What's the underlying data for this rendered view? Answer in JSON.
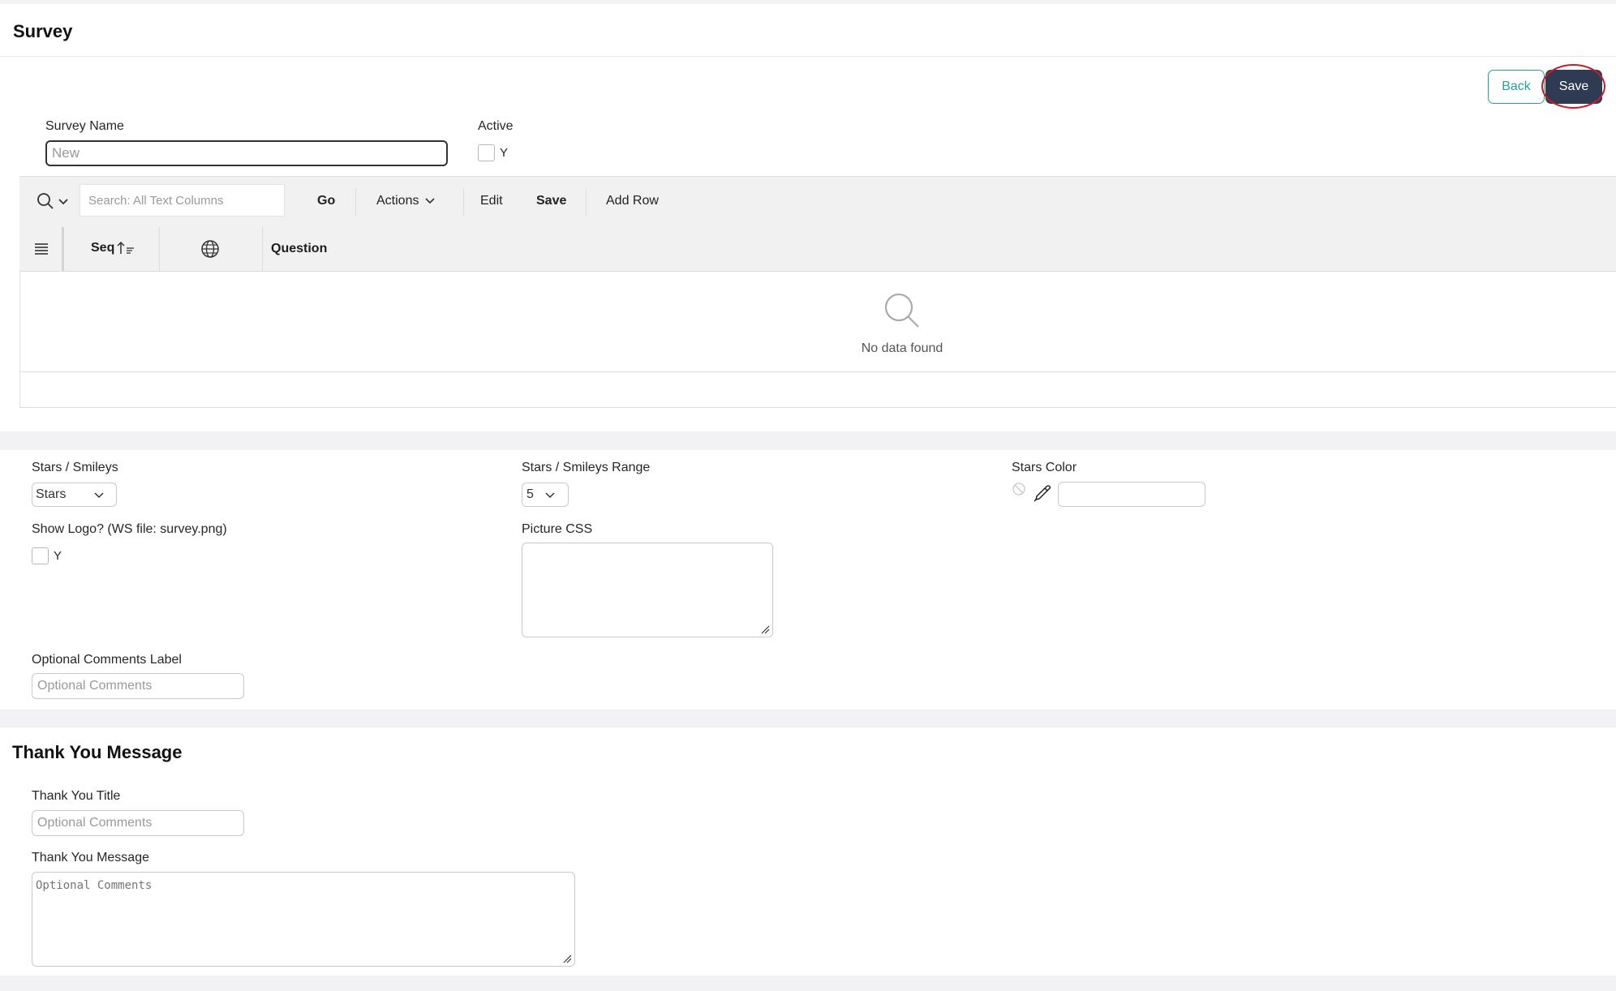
{
  "header": {
    "title": "Survey"
  },
  "buttons": {
    "back": "Back",
    "save": "Save"
  },
  "form": {
    "survey_name_label": "Survey Name",
    "survey_name_placeholder": "New",
    "active_label": "Active",
    "active_option": "Y"
  },
  "grid": {
    "search_placeholder": "Search: All Text Columns",
    "go": "Go",
    "actions": "Actions",
    "edit": "Edit",
    "save": "Save",
    "add_row": "Add Row",
    "columns": {
      "seq": "Seq",
      "question": "Question"
    },
    "empty_text": "No data found"
  },
  "settings": {
    "stars_smileys_label": "Stars / Smileys",
    "stars_smileys_value": "Stars",
    "range_label": "Stars / Smileys Range",
    "range_value": "5",
    "stars_color_label": "Stars Color",
    "show_logo_label": "Show Logo? (WS file: survey.png)",
    "show_logo_option": "Y",
    "picture_css_label": "Picture CSS",
    "optional_comments_label": "Optional Comments Label",
    "optional_comments_placeholder": "Optional Comments"
  },
  "thank_you": {
    "section_title": "Thank You Message",
    "title_label": "Thank You Title",
    "title_placeholder": "Optional Comments",
    "message_label": "Thank You Message",
    "message_placeholder": "Optional Comments"
  },
  "colors": {
    "save_button_bg": "#2f3b52",
    "back_button_border": "#2a9d9d",
    "highlight_ring": "#c0202a",
    "toolbar_bg": "#f1f1f1"
  }
}
